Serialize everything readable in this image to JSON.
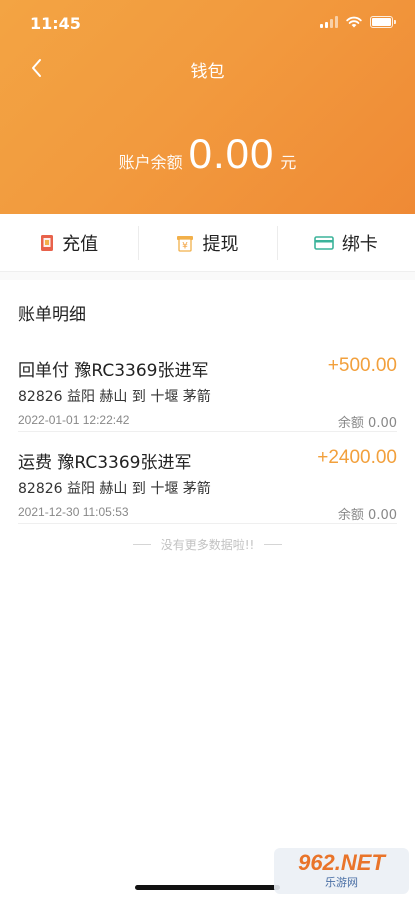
{
  "status_bar": {
    "time": "11:45"
  },
  "nav": {
    "title": "钱包"
  },
  "balance": {
    "label": "账户余额",
    "value": "0.00",
    "unit": "元"
  },
  "actions": [
    {
      "label": "充值",
      "icon": "recharge-icon"
    },
    {
      "label": "提现",
      "icon": "withdraw-icon"
    },
    {
      "label": "绑卡",
      "icon": "card-icon"
    }
  ],
  "section": {
    "title": "账单明细"
  },
  "transactions": [
    {
      "title": "回单付 豫RC3369张进军",
      "amount": "+500.00",
      "route": "82826 益阳 赫山 到 十堰 茅箭",
      "time": "2022-01-01 12:22:42",
      "balance": "余额 0.00"
    },
    {
      "title": "运费 豫RC3369张进军",
      "amount": "+2400.00",
      "route": "82826 益阳 赫山 到 十堰 茅箭",
      "time": "2021-12-30 11:05:53",
      "balance": "余额 0.00"
    }
  ],
  "footer": {
    "no_more": "没有更多数据啦!!"
  },
  "watermark": {
    "top": "962.NET",
    "bottom": "乐游网"
  },
  "colors": {
    "header_orange": "#f29a3e",
    "amount_orange": "#f2a03c"
  }
}
